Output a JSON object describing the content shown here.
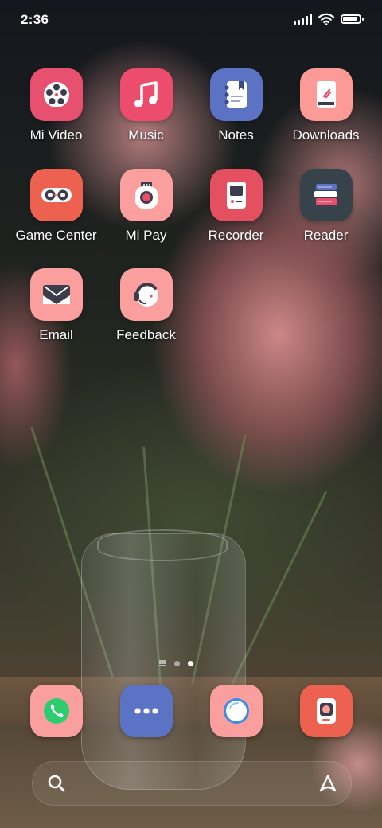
{
  "status_bar": {
    "time": "2:36",
    "signal_icon": "cellular-signal-icon",
    "wifi_icon": "wifi-icon",
    "battery_icon": "battery-icon",
    "battery_level": 0.9
  },
  "apps": [
    {
      "name": "Mi Video",
      "icon": "film-reel-icon",
      "color": "#e8506f"
    },
    {
      "name": "Music",
      "icon": "music-note-icon",
      "color": "#ec4d6c"
    },
    {
      "name": "Notes",
      "icon": "notepad-icon",
      "color": "#5c72c4"
    },
    {
      "name": "Downloads",
      "icon": "download-icon",
      "color": "#fb9a97"
    },
    {
      "name": "Game Center",
      "icon": "gamepad-icon",
      "color": "#ec6150"
    },
    {
      "name": "Mi Pay",
      "icon": "wallet-icon",
      "color": "#fb9f9e"
    },
    {
      "name": "Recorder",
      "icon": "recorder-icon",
      "color": "#e4505f"
    },
    {
      "name": "Reader",
      "icon": "books-icon",
      "color": "#37434a"
    },
    {
      "name": "Email",
      "icon": "envelope-icon",
      "color": "#fb9f9e"
    },
    {
      "name": "Feedback",
      "icon": "headset-icon",
      "color": "#fb9f9e"
    }
  ],
  "pager": {
    "pages": 2,
    "active": 2
  },
  "dock": [
    {
      "icon": "phone-icon",
      "color": "#fb9f9e"
    },
    {
      "icon": "messages-icon",
      "color": "#5c72c4"
    },
    {
      "icon": "browser-icon",
      "color": "#fb9f9e"
    },
    {
      "icon": "camera-icon",
      "color": "#ec6150"
    }
  ],
  "search_bar": {
    "search_icon": "search-icon",
    "assistant_icon": "assistant-icon"
  }
}
